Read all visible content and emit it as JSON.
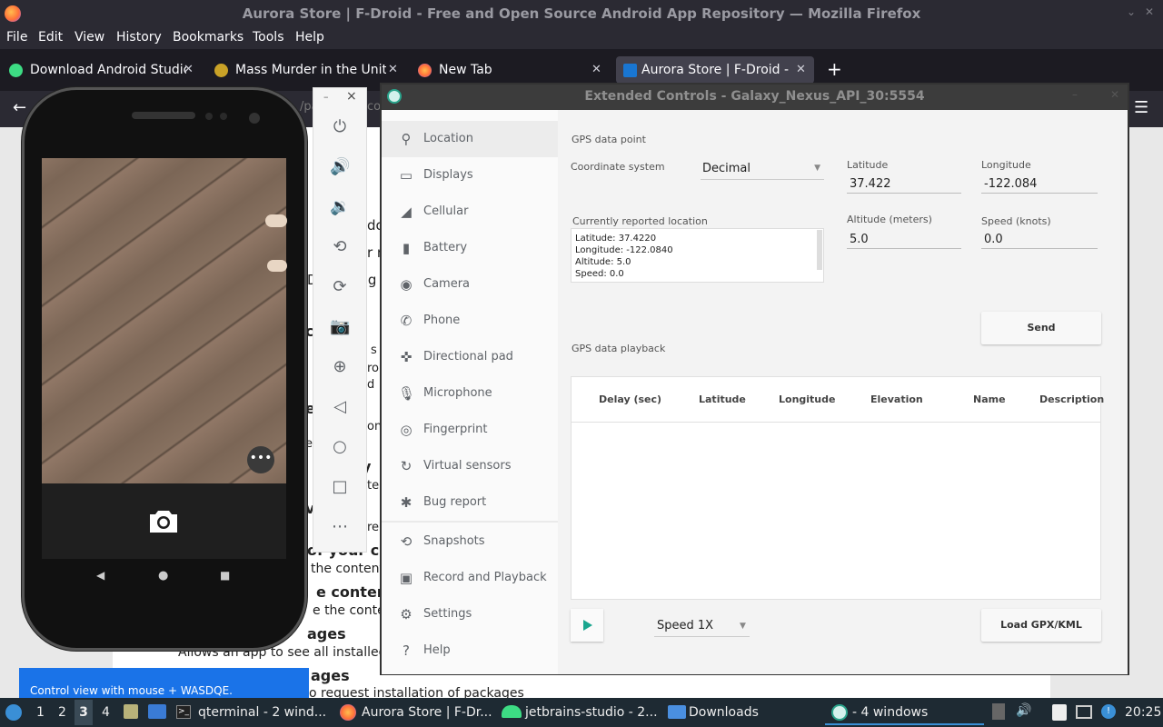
{
  "firefox": {
    "title": "Aurora Store | F-Droid - Free and Open Source Android App Repository — Mozilla Firefox",
    "menu": [
      "File",
      "Edit",
      "View",
      "History",
      "Bookmarks",
      "Tools",
      "Help"
    ],
    "tabs": [
      {
        "label": "Download Android Studio",
        "color": "#3ddc84"
      },
      {
        "label": "Mass Murder in the United",
        "color": "#c9a227"
      },
      {
        "label": "New Tab",
        "color": "#ff7139"
      },
      {
        "label": "Aurora Store | F-Droid - Free",
        "color": "#1976d2"
      }
    ],
    "new_tab": "+",
    "url_fragment": "/pa",
    "url_fragment2": "co"
  },
  "page": {
    "fragments": [
      {
        "text": "do"
      },
      {
        "text": "r n"
      },
      {
        "text": "D"
      },
      {
        "text": "l g"
      },
      {
        "text": "c"
      },
      {
        "text": "s"
      },
      {
        "text": "ro"
      },
      {
        "text": "d"
      },
      {
        "text": "e"
      },
      {
        "text": "on"
      },
      {
        "text": "ed"
      },
      {
        "text": "y"
      },
      {
        "text": "te"
      },
      {
        "text": "vi"
      },
      {
        "text": "re"
      }
    ],
    "lines": [
      {
        "text": "of your char",
        "bold": true
      },
      {
        "text": "the contents",
        "bold": false
      },
      {
        "text": "e contents",
        "bold": true
      },
      {
        "text": "e the content",
        "bold": false
      },
      {
        "text": "ages",
        "bold": true
      },
      {
        "text": "Allows an app to see all installed pa",
        "bold": false
      },
      {
        "text": "ages",
        "bold": true
      },
      {
        "text": "o request installation of packages",
        "bold": false
      }
    ],
    "hint": "Control view with mouse + WASDQE."
  },
  "phone": {
    "more": "•••"
  },
  "emulator_toolbar": {
    "min": "–",
    "close": "×",
    "items": [
      "power-icon",
      "volume-up-icon",
      "volume-down-icon",
      "rotate-left-icon",
      "rotate-right-icon",
      "screenshot-icon",
      "zoom-icon",
      "back-icon",
      "home-icon",
      "overview-icon",
      "more-icon"
    ]
  },
  "extended_controls": {
    "title": "Extended Controls - Galaxy_Nexus_API_30:5554",
    "nav": [
      {
        "label": "Location",
        "icon": "location-icon"
      },
      {
        "label": "Displays",
        "icon": "displays-icon"
      },
      {
        "label": "Cellular",
        "icon": "cellular-icon"
      },
      {
        "label": "Battery",
        "icon": "battery-icon"
      },
      {
        "label": "Camera",
        "icon": "camera-icon"
      },
      {
        "label": "Phone",
        "icon": "phone-icon"
      },
      {
        "label": "Directional pad",
        "icon": "dpad-icon"
      },
      {
        "label": "Microphone",
        "icon": "microphone-icon"
      },
      {
        "label": "Fingerprint",
        "icon": "fingerprint-icon"
      },
      {
        "label": "Virtual sensors",
        "icon": "virtual-sensors-icon"
      },
      {
        "label": "Bug report",
        "icon": "bug-report-icon"
      },
      {
        "label": "Snapshots",
        "icon": "snapshots-icon"
      },
      {
        "label": "Record and Playback",
        "icon": "record-icon"
      },
      {
        "label": "Settings",
        "icon": "settings-icon"
      },
      {
        "label": "Help",
        "icon": "help-icon"
      }
    ],
    "gps_point_title": "GPS data point",
    "coord_label": "Coordinate system",
    "coord_value": "Decimal",
    "lat_label": "Latitude",
    "lat_value": "37.422",
    "lon_label": "Longitude",
    "lon_value": "-122.084",
    "alt_label": "Altitude (meters)",
    "alt_value": "5.0",
    "speed_label": "Speed (knots)",
    "speed_value": "0.0",
    "reported_label": "Currently reported location",
    "reported_lines": [
      "Latitude: 37.4220",
      "Longitude: -122.0840",
      "Altitude: 5.0",
      "Speed: 0.0"
    ],
    "send": "Send",
    "playback_title": "GPS data playback",
    "columns": [
      "Delay (sec)",
      "Latitude",
      "Longitude",
      "Elevation",
      "Name",
      "Description"
    ],
    "speed_select": "Speed 1X",
    "load": "Load GPX/KML"
  },
  "taskbar": {
    "workspaces": [
      "1",
      "2",
      "3",
      "4"
    ],
    "windows": [
      {
        "label": "qterminal - 2 wind..."
      },
      {
        "label": "Aurora Store | F-Dr..."
      },
      {
        "label": "jetbrains-studio - 2..."
      },
      {
        "label": "Downloads"
      },
      {
        "label": "- 4 windows"
      }
    ],
    "clock": "20:25"
  }
}
